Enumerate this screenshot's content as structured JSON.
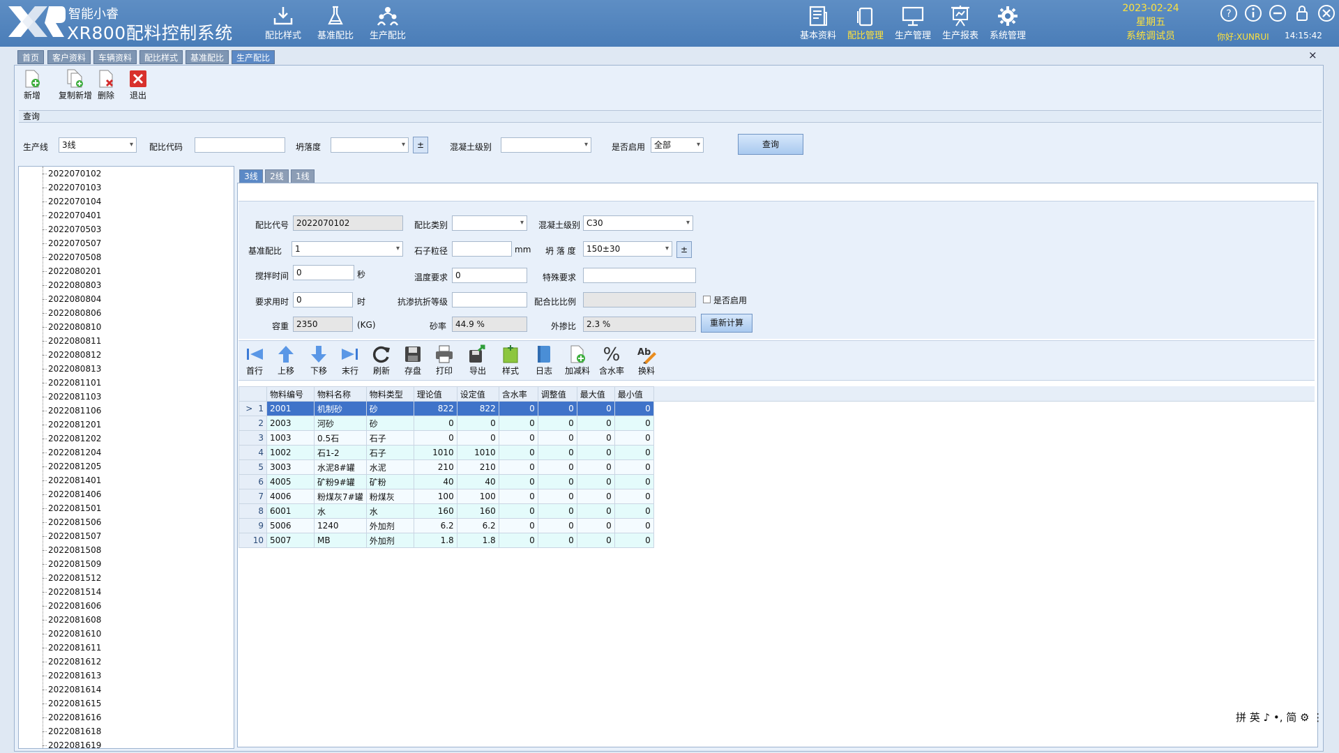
{
  "app": {
    "brand_line1": "智能小睿",
    "brand_line2": "XR800配料控制系统",
    "date": "2023-02-24",
    "weekday": "星期五",
    "user_role": "系统调试员",
    "greeting": "你好:XUNRUI",
    "time": "14:15:42",
    "accent_color": "#ffe23b",
    "header_color": "#4a7db8"
  },
  "header_nav_left": [
    {
      "label": "配比样式",
      "icon": "download-tray-icon"
    },
    {
      "label": "基准配比",
      "icon": "flask-icon"
    },
    {
      "label": "生产配比",
      "icon": "people-icon"
    }
  ],
  "header_nav_right": [
    {
      "label": "基本资料",
      "icon": "newspaper-icon"
    },
    {
      "label": "配比管理",
      "icon": "copy-doc-icon",
      "active": true
    },
    {
      "label": "生产管理",
      "icon": "monitor-icon"
    },
    {
      "label": "生产报表",
      "icon": "report-icon"
    },
    {
      "label": "系统管理",
      "icon": "gear-icon"
    }
  ],
  "page_tabs": [
    "首页",
    "客户资料",
    "车辆资料",
    "配比样式",
    "基准配比",
    "生产配比"
  ],
  "active_page_tab": "生产配比",
  "toolbar": [
    "新增",
    "复制新增",
    "删除",
    "退出"
  ],
  "query_section_label": "查询",
  "filters": {
    "line_label": "生产线",
    "line_value": "3线",
    "code_label": "配比代码",
    "code_value": "",
    "slump_label": "坍落度",
    "slump_value": "",
    "pm": "±",
    "grade_label": "混凝土级别",
    "grade_value": "",
    "enabled_label": "是否启用",
    "enabled_value": "全部",
    "query_button": "查询"
  },
  "tree_items": [
    "2022070102",
    "2022070103",
    "2022070104",
    "2022070401",
    "2022070503",
    "2022070507",
    "2022070508",
    "2022080201",
    "2022080803",
    "2022080804",
    "2022080806",
    "2022080810",
    "2022080811",
    "2022080812",
    "2022080813",
    "2022081101",
    "2022081103",
    "2022081106",
    "2022081201",
    "2022081202",
    "2022081204",
    "2022081205",
    "2022081401",
    "2022081406",
    "2022081501",
    "2022081506",
    "2022081507",
    "2022081508",
    "2022081509",
    "2022081512",
    "2022081514",
    "2022081606",
    "2022081608",
    "2022081610",
    "2022081611",
    "2022081612",
    "2022081613",
    "2022081614",
    "2022081615",
    "2022081616",
    "2022081618",
    "2022081619"
  ],
  "line_tabs": [
    "3线",
    "2线",
    "1线"
  ],
  "active_line_tab": "3线",
  "form": {
    "code_label": "配比代号",
    "code_value": "2022070102",
    "category_label": "配比类别",
    "category_value": "",
    "grade_label": "混凝土级别",
    "grade_value": "C30",
    "base_label": "基准配比",
    "base_value": "1",
    "stone_label": "石子粒径",
    "stone_value": "",
    "stone_unit": "mm",
    "slump_label": "坍 落 度",
    "slump_value": "150±30",
    "pm": "±",
    "mix_time_label": "搅拌时间",
    "mix_time_value": "0",
    "mix_time_unit": "秒",
    "temp_label": "温度要求",
    "temp_value": "0",
    "special_label": "特殊要求",
    "special_value": "",
    "req_time_label": "要求用时",
    "req_time_value": "0",
    "req_time_unit": "时",
    "impermeability_label": "抗渗抗折等级",
    "impermeability_value": "",
    "ratio_label": "配合比比例",
    "ratio_value": "",
    "enabled_label": "是否启用",
    "capacity_label": "容重",
    "capacity_value": "2350",
    "capacity_unit": "(KG)",
    "sand_label": "砂率",
    "sand_value": "44.9 %",
    "additive_label": "外掺比",
    "additive_value": "2.3 %",
    "recalc_button": "重新计算"
  },
  "grid_toolbar": [
    {
      "label": "首行",
      "icon": "first-row-icon"
    },
    {
      "label": "上移",
      "icon": "arrow-up-icon"
    },
    {
      "label": "下移",
      "icon": "arrow-down-icon"
    },
    {
      "label": "末行",
      "icon": "last-row-icon"
    },
    {
      "label": "刷新",
      "icon": "refresh-icon"
    },
    {
      "label": "存盘",
      "icon": "save-icon"
    },
    {
      "label": "打印",
      "icon": "print-icon"
    },
    {
      "label": "导出",
      "icon": "export-icon"
    },
    {
      "label": "样式",
      "icon": "style-icon"
    },
    {
      "label": "日志",
      "icon": "log-icon"
    },
    {
      "label": "加减料",
      "icon": "add-material-icon"
    },
    {
      "label": "含水率",
      "icon": "percent-icon"
    },
    {
      "label": "换料",
      "icon": "replace-icon"
    }
  ],
  "grid": {
    "columns": [
      "物料编号",
      "物料名称",
      "物料类型",
      "理论值",
      "设定值",
      "含水率",
      "调整值",
      "最大值",
      "最小值"
    ],
    "rows": [
      [
        "1",
        "2001",
        "机制砂",
        "砂",
        "822",
        "822",
        "0",
        "0",
        "0",
        "0"
      ],
      [
        "2",
        "2003",
        "河砂",
        "砂",
        "0",
        "0",
        "0",
        "0",
        "0",
        "0"
      ],
      [
        "3",
        "1003",
        "0.5石",
        "石子",
        "0",
        "0",
        "0",
        "0",
        "0",
        "0"
      ],
      [
        "4",
        "1002",
        "石1-2",
        "石子",
        "1010",
        "1010",
        "0",
        "0",
        "0",
        "0"
      ],
      [
        "5",
        "3003",
        "水泥8#罐",
        "水泥",
        "210",
        "210",
        "0",
        "0",
        "0",
        "0"
      ],
      [
        "6",
        "4005",
        "矿粉9#罐",
        "矿粉",
        "40",
        "40",
        "0",
        "0",
        "0",
        "0"
      ],
      [
        "7",
        "4006",
        "粉煤灰7#罐",
        "粉煤灰",
        "100",
        "100",
        "0",
        "0",
        "0",
        "0"
      ],
      [
        "8",
        "6001",
        "水",
        "水",
        "160",
        "160",
        "0",
        "0",
        "0",
        "0"
      ],
      [
        "9",
        "5006",
        "1240",
        "外加剂",
        "6.2",
        "6.2",
        "0",
        "0",
        "0",
        "0"
      ],
      [
        "10",
        "5007",
        "MB",
        "外加剂",
        "1.8",
        "1.8",
        "0",
        "0",
        "0",
        "0"
      ]
    ],
    "selected_row": 0,
    "row_indicator": ">"
  },
  "ime": "拼 英 ♪ •, 简 ⚙ ⋮"
}
